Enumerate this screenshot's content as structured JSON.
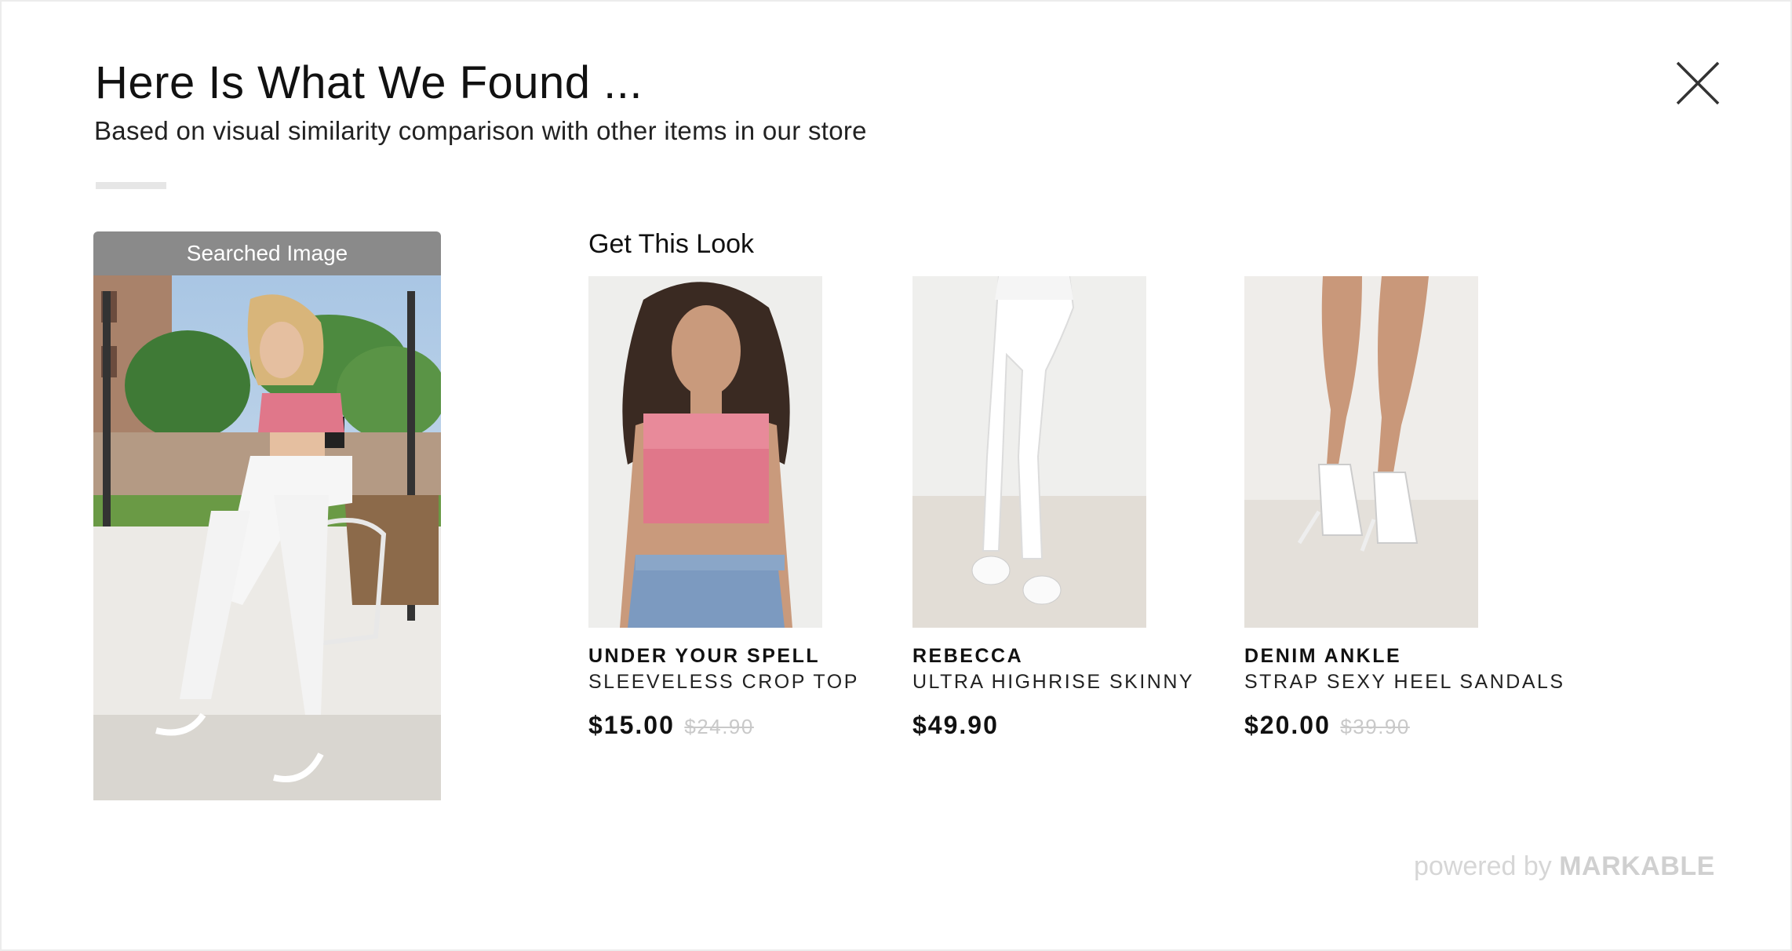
{
  "header": {
    "title": "Here Is What We Found ...",
    "subtitle": "Based on visual similarity comparison with other items in our store"
  },
  "searched": {
    "label": "Searched Image"
  },
  "look": {
    "title": "Get This Look",
    "products": [
      {
        "brand": "UNDER YOUR SPELL",
        "name": "SLEEVELESS CROP TOP",
        "price": "$15.00",
        "original_price": "$24.90"
      },
      {
        "brand": "REBECCA",
        "name": "ULTRA HIGHRISE SKINNY",
        "price": "$49.90",
        "original_price": ""
      },
      {
        "brand": "DENIM ANKLE",
        "name": "STRAP SEXY HEEL SANDALS",
        "price": "$20.00",
        "original_price": "$39.90"
      }
    ]
  },
  "footer": {
    "powered_by": "powered by",
    "brand": "MARKABLE"
  },
  "icons": {
    "close": "close-icon"
  },
  "colors": {
    "header_bar": "#8a8a8a",
    "strike_price": "#c9c9c9",
    "powered": "#d6d6d6"
  }
}
